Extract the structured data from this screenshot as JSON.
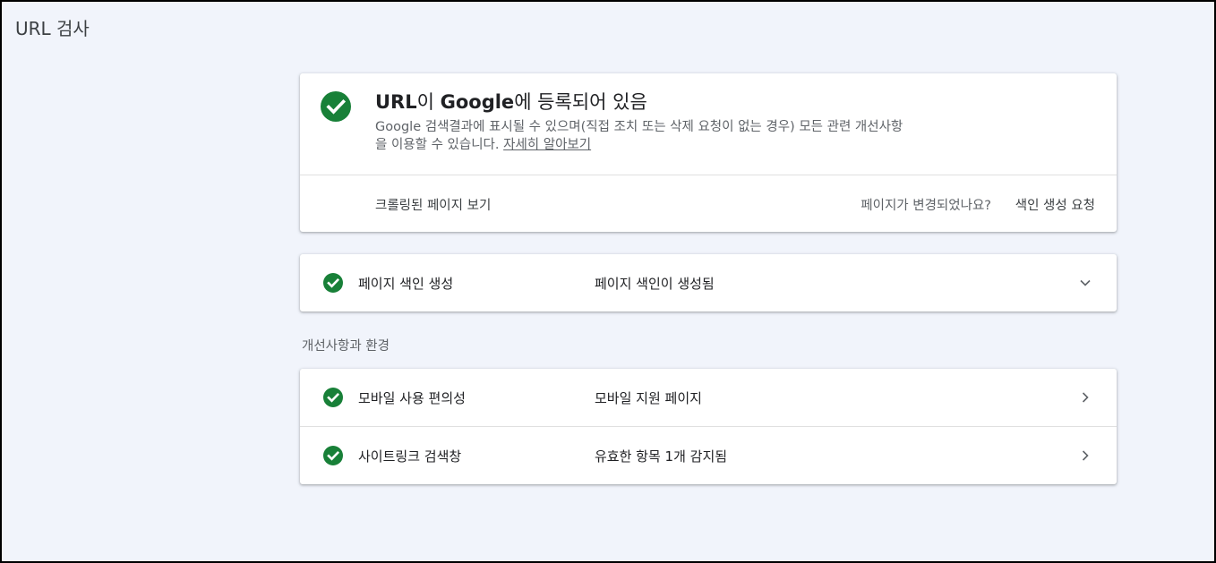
{
  "page": {
    "title": "URL 검사"
  },
  "status": {
    "title_prefix": "URL",
    "title_mid": "이 ",
    "title_brand": "Google",
    "title_suffix": "에 등록되어 있음",
    "description": "Google 검색결과에 표시될 수 있으며(직접 조치 또는 삭제 요청이 없는 경우) 모든 관련 개선사항을 이용할 수 있습니다.",
    "learn_more": "자세히 알아보기",
    "view_crawled": "크롤링된 페이지 보기",
    "changed_question": "페이지가 변경되었나요?",
    "request_indexing": "색인 생성 요청",
    "icon": "check-circle-icon"
  },
  "indexing": {
    "label": "페이지 색인 생성",
    "value": "페이지 색인이 생성됨",
    "icon": "check-circle-icon",
    "chevron": "chevron-down-icon"
  },
  "enhancements": {
    "heading": "개선사항과 환경",
    "items": [
      {
        "label": "모바일 사용 편의성",
        "value": "모바일 지원 페이지",
        "icon": "check-circle-icon",
        "chevron": "chevron-right-icon"
      },
      {
        "label": "사이트링크 검색창",
        "value": "유효한 항목 1개 감지됨",
        "icon": "check-circle-icon",
        "chevron": "chevron-right-icon"
      }
    ]
  },
  "colors": {
    "success": "#188038",
    "background": "#f1f4fb"
  }
}
